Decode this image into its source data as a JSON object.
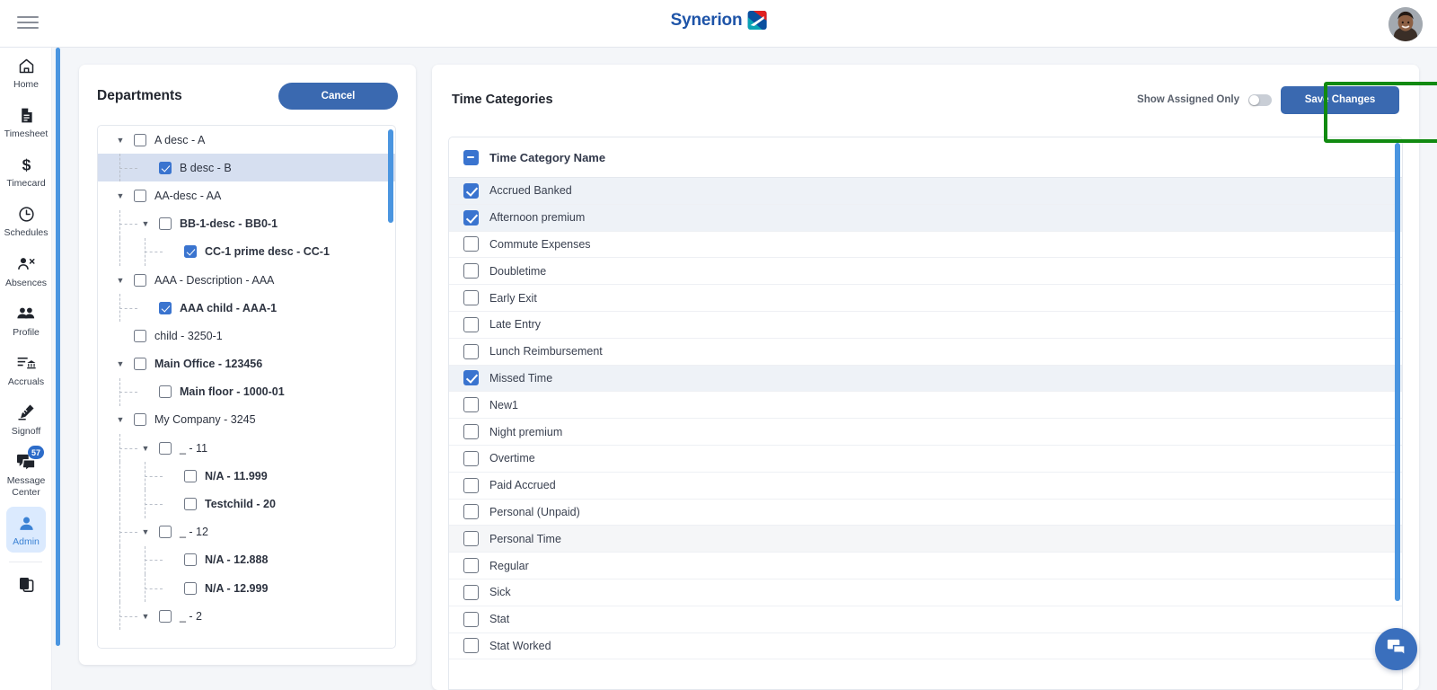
{
  "header": {
    "menu_icon": "hamburger-icon",
    "brand_text": "Synerion",
    "brand_mark_icon": "synerion-logo-icon",
    "avatar_icon": "user-avatar",
    "brand_color": "#1e54a8"
  },
  "sidebar": {
    "items": [
      {
        "label": "Home",
        "icon": "home-icon",
        "active": false
      },
      {
        "label": "Timesheet",
        "icon": "document-icon",
        "active": false
      },
      {
        "label": "Timecard",
        "icon": "dollar-icon",
        "active": false
      },
      {
        "label": "Schedules",
        "icon": "clock-icon",
        "active": false
      },
      {
        "label": "Absences",
        "icon": "person-remove-icon",
        "active": false
      },
      {
        "label": "Profile",
        "icon": "people-icon",
        "active": false
      },
      {
        "label": "Accruals",
        "icon": "list-bank-icon",
        "active": false
      },
      {
        "label": "Signoff",
        "icon": "signature-icon",
        "active": false
      },
      {
        "label": "Message Center",
        "icon": "chat-icon",
        "badge": "57",
        "active": false
      },
      {
        "label": "Admin",
        "icon": "person-icon",
        "active": true
      }
    ],
    "footer_icon": "copy-pages-icon",
    "active_color": "#3b82d4"
  },
  "departments": {
    "title": "Departments",
    "cancel_label": "Cancel",
    "tree": [
      {
        "label": "A desc - A",
        "depth": 0,
        "caret": true,
        "checked": false,
        "bold": false,
        "selected": false
      },
      {
        "label": "B desc - B",
        "depth": 1,
        "caret": false,
        "checked": true,
        "bold": false,
        "selected": true
      },
      {
        "label": "AA-desc - AA",
        "depth": 0,
        "caret": true,
        "checked": false,
        "bold": false,
        "selected": false
      },
      {
        "label": "BB-1-desc - BB0-1",
        "depth": 1,
        "caret": true,
        "checked": false,
        "bold": true,
        "selected": false
      },
      {
        "label": "CC-1 prime desc - CC-1",
        "depth": 2,
        "caret": false,
        "checked": true,
        "bold": true,
        "selected": false
      },
      {
        "label": "AAA - Description - AAA",
        "depth": 0,
        "caret": true,
        "checked": false,
        "bold": false,
        "selected": false
      },
      {
        "label": "AAA child - AAA-1",
        "depth": 1,
        "caret": false,
        "checked": true,
        "bold": true,
        "selected": false
      },
      {
        "label": "child - 3250-1",
        "depth": 0,
        "caret": false,
        "checked": false,
        "bold": false,
        "selected": false
      },
      {
        "label": "Main Office - 123456",
        "depth": 0,
        "caret": true,
        "checked": false,
        "bold": true,
        "selected": false
      },
      {
        "label": "Main floor - 1000-01",
        "depth": 1,
        "caret": false,
        "checked": false,
        "bold": true,
        "selected": false
      },
      {
        "label": "My Company - 3245",
        "depth": 0,
        "caret": true,
        "checked": false,
        "bold": false,
        "selected": false
      },
      {
        "label": "_ - 11",
        "depth": 1,
        "caret": true,
        "checked": false,
        "bold": false,
        "selected": false
      },
      {
        "label": "N/A - 11.999",
        "depth": 2,
        "caret": false,
        "checked": false,
        "bold": true,
        "selected": false
      },
      {
        "label": "Testchild - 20",
        "depth": 2,
        "caret": false,
        "checked": false,
        "bold": true,
        "selected": false
      },
      {
        "label": "_ - 12",
        "depth": 1,
        "caret": true,
        "checked": false,
        "bold": false,
        "selected": false
      },
      {
        "label": "N/A - 12.888",
        "depth": 2,
        "caret": false,
        "checked": false,
        "bold": true,
        "selected": false
      },
      {
        "label": "N/A - 12.999",
        "depth": 2,
        "caret": false,
        "checked": false,
        "bold": true,
        "selected": false
      },
      {
        "label": "_ - 2",
        "depth": 1,
        "caret": true,
        "checked": false,
        "bold": false,
        "selected": false
      }
    ]
  },
  "time_categories": {
    "title": "Time Categories",
    "toggle_label": "Show Assigned Only",
    "toggle_on": false,
    "save_label": "Save Changes",
    "highlight_color": "#118a11",
    "column_header": "Time Category Name",
    "header_checkbox_state": "indeterminate",
    "rows": [
      {
        "label": "Accrued Banked",
        "checked": true
      },
      {
        "label": "Afternoon premium",
        "checked": true
      },
      {
        "label": "Commute Expenses",
        "checked": false
      },
      {
        "label": "Doubletime",
        "checked": false
      },
      {
        "label": "Early Exit",
        "checked": false
      },
      {
        "label": "Late Entry",
        "checked": false
      },
      {
        "label": "Lunch Reimbursement",
        "checked": false
      },
      {
        "label": "Missed Time",
        "checked": true
      },
      {
        "label": "New1",
        "checked": false
      },
      {
        "label": "Night premium",
        "checked": false
      },
      {
        "label": "Overtime",
        "checked": false
      },
      {
        "label": "Paid Accrued",
        "checked": false
      },
      {
        "label": "Personal (Unpaid)",
        "checked": false
      },
      {
        "label": "Personal Time",
        "checked": false,
        "hover": true
      },
      {
        "label": "Regular",
        "checked": false
      },
      {
        "label": "Sick",
        "checked": false
      },
      {
        "label": "Stat",
        "checked": false
      },
      {
        "label": "Stat Worked",
        "checked": false
      }
    ]
  },
  "chat_fab": {
    "icon": "chat-bubble-icon",
    "color": "#3a6fbd"
  }
}
